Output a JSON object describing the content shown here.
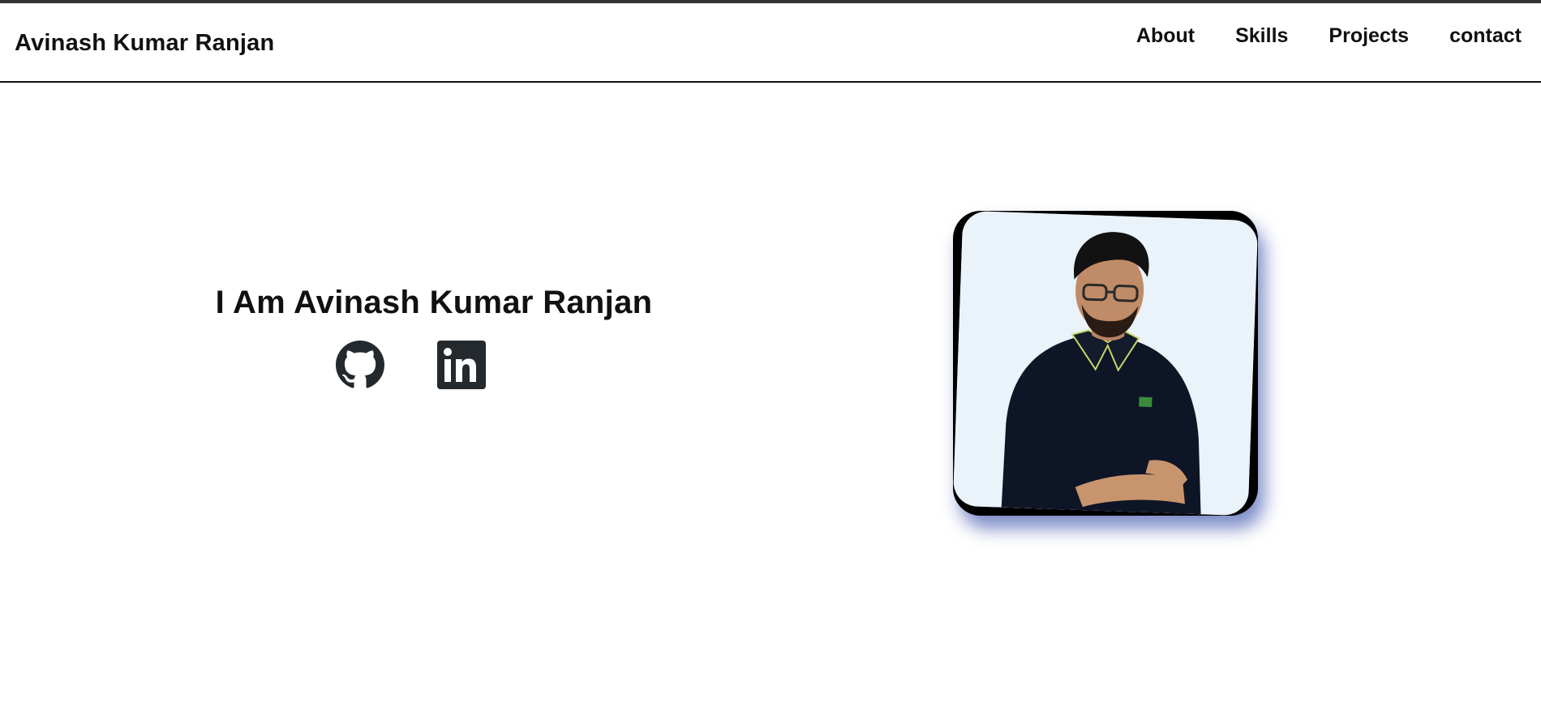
{
  "header": {
    "brand": "Avinash Kumar Ranjan",
    "nav": [
      {
        "label": "About"
      },
      {
        "label": "Skills"
      },
      {
        "label": "Projects"
      },
      {
        "label": "contact"
      }
    ]
  },
  "hero": {
    "title": "I Am Avinash Kumar Ranjan",
    "social": [
      {
        "icon": "github-icon"
      },
      {
        "icon": "linkedin-icon"
      }
    ],
    "photo_icon": "profile-photo"
  },
  "colors": {
    "text": "#111111",
    "icon": "#24292e",
    "shadow": "#3750aa"
  }
}
